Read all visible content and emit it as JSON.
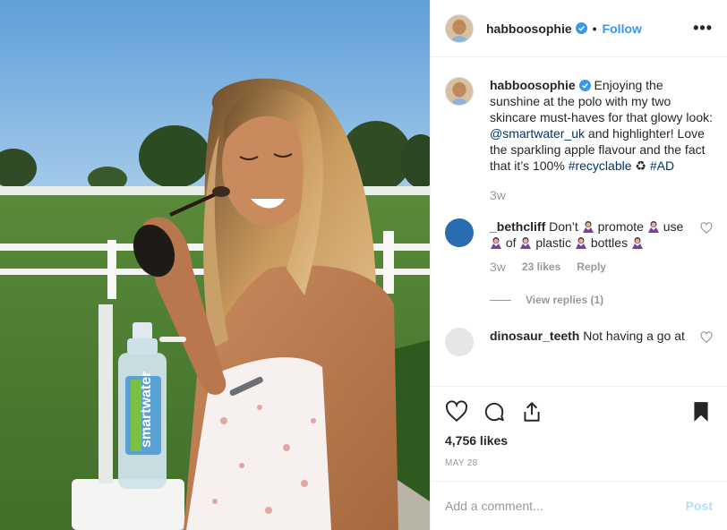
{
  "post": {
    "username": "habboosophie",
    "follow_label": "Follow",
    "separator": "•",
    "more_label": "•••"
  },
  "caption": {
    "username": "habboosophie",
    "text_before": " Enjoying the sunshine at the polo with my two skincare must-haves for that glowy look: ",
    "mention": "@smartwater_uk",
    "text_middle": " and highlighter! Love the sparkling apple flavour and the fact that it’s 100% ",
    "hashtag1": "#recyclable",
    "recycle_glyph": "♻",
    "hashtag2": "#AD",
    "time": "3w"
  },
  "comments": [
    {
      "username": "_bethcliff",
      "w1": "Don’t",
      "w2": "promote",
      "w3": "use",
      "w4": "of",
      "w5": "plastic",
      "w6": "bottles",
      "time": "3w",
      "likes": "23 likes",
      "reply_label": "Reply",
      "view_replies": "View replies (1)"
    },
    {
      "username": "dinosaur_teeth",
      "text": "Not having a go at"
    }
  ],
  "bottle": {
    "brand": "smartwater"
  },
  "likes_count": "4,756 likes",
  "date": "MAY 28",
  "add_comment": {
    "placeholder": "Add a comment...",
    "post_label": "Post"
  },
  "colors": {
    "link": "#003569",
    "accent": "#3897f0",
    "post_disabled": "#b2dffc",
    "verified": "#3897f0"
  }
}
